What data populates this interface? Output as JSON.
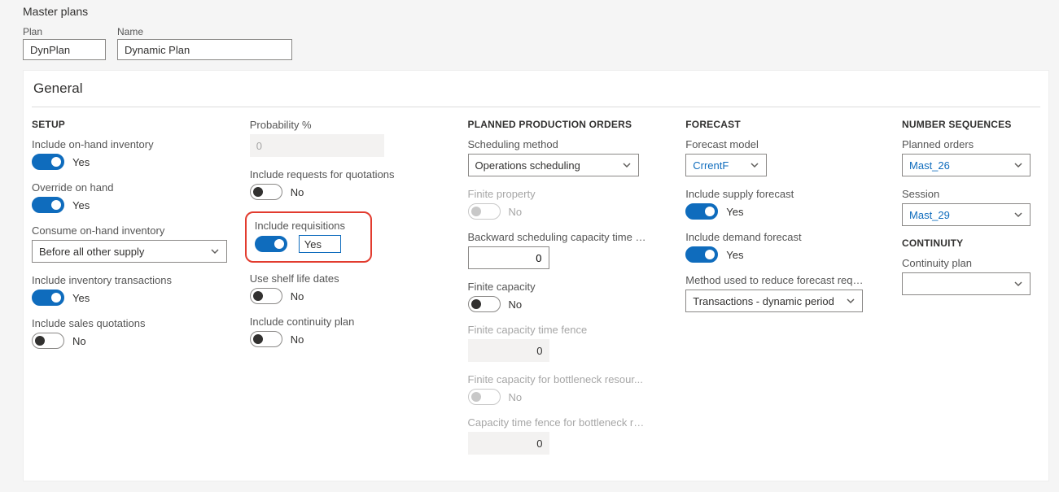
{
  "page_title": "Master plans",
  "header": {
    "plan_label": "Plan",
    "plan_value": "DynPlan",
    "name_label": "Name",
    "name_value": "Dynamic Plan"
  },
  "panel_title": "General",
  "words": {
    "yes": "Yes",
    "no": "No"
  },
  "setup": {
    "heading": "SETUP",
    "include_onhand_label": "Include on-hand inventory",
    "include_onhand_on": true,
    "override_onhand_label": "Override on hand",
    "override_onhand_on": true,
    "consume_onhand_label": "Consume on-hand inventory",
    "consume_onhand_value": "Before all other supply",
    "include_invtrans_label": "Include inventory transactions",
    "include_invtrans_on": true,
    "include_salesquot_label": "Include sales quotations",
    "include_salesquot_on": false
  },
  "setup2": {
    "probability_label": "Probability %",
    "probability_value": "0",
    "include_rfq_label": "Include requests for quotations",
    "include_rfq_on": false,
    "include_req_label": "Include requisitions",
    "include_req_on": true,
    "include_req_value": "Yes",
    "use_shelf_label": "Use shelf life dates",
    "use_shelf_on": false,
    "include_cont_label": "Include continuity plan",
    "include_cont_on": false
  },
  "ppo": {
    "heading": "PLANNED PRODUCTION ORDERS",
    "sched_method_label": "Scheduling method",
    "sched_method_value": "Operations scheduling",
    "finite_property_label": "Finite property",
    "finite_property_on": false,
    "finite_property_disabled": true,
    "backward_label": "Backward scheduling capacity time fe...",
    "backward_value": "0",
    "finite_capacity_label": "Finite capacity",
    "finite_capacity_on": false,
    "fc_timefence_label": "Finite capacity time fence",
    "fc_timefence_value": "0",
    "fc_bottleneck_label": "Finite capacity for bottleneck resour...",
    "fc_bottleneck_on": false,
    "fc_bottleneck_disabled": true,
    "cap_bottleneck_label": "Capacity time fence for bottleneck res...",
    "cap_bottleneck_value": "0"
  },
  "forecast": {
    "heading": "FORECAST",
    "model_label": "Forecast model",
    "model_value": "CrrentF",
    "include_supply_label": "Include supply forecast",
    "include_supply_on": true,
    "include_demand_label": "Include demand forecast",
    "include_demand_on": true,
    "reduce_method_label": "Method used to reduce forecast requir...",
    "reduce_method_value": "Transactions - dynamic period"
  },
  "numseq": {
    "heading": "NUMBER SEQUENCES",
    "planned_orders_label": "Planned orders",
    "planned_orders_value": "Mast_26",
    "session_label": "Session",
    "session_value": "Mast_29",
    "continuity_heading": "CONTINUITY",
    "continuity_plan_label": "Continuity plan",
    "continuity_plan_value": ""
  }
}
